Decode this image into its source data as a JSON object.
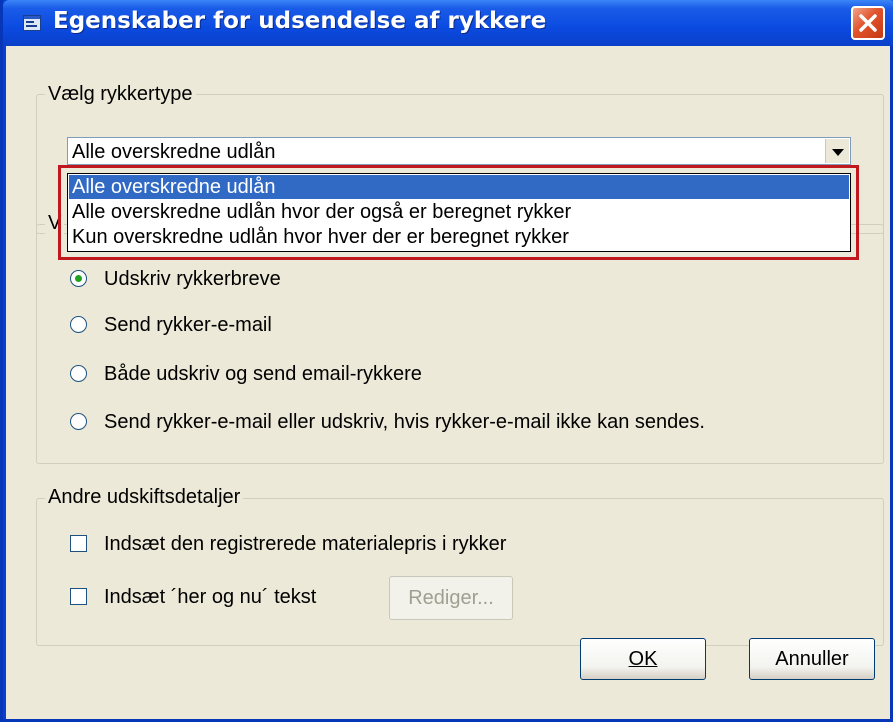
{
  "window": {
    "title": "Egenskaber for udsendelse af rykkere",
    "icon": "app-window-icon",
    "close_icon": "close-icon",
    "accent": "#0a3fd4",
    "dialog_bg": "#ece9d8"
  },
  "reminder_type_group": {
    "legend": "Vælg rykkertype",
    "combo_value": "Alle overskredne udlån",
    "options": [
      "Alle overskredne udlån",
      "Alle overskredne udlån hvor der også er beregnet rykker",
      "Kun overskredne udlån hvor hver der er beregnet rykker"
    ],
    "selected_index": 0,
    "highlight_color": "#c0181e"
  },
  "delivery_group": {
    "legend_visible_fragment": "V",
    "options": [
      {
        "label": "Udskriv rykkerbreve",
        "selected": true
      },
      {
        "label": "Send rykker-e-mail",
        "selected": false
      },
      {
        "label": "Både udskriv og send email-rykkere",
        "selected": false
      },
      {
        "label": "Send rykker-e-mail eller udskriv, hvis rykker-e-mail ikke kan sendes.",
        "selected": false
      }
    ]
  },
  "other_details_group": {
    "legend": "Andre udskiftsdetaljer",
    "material_price_label": "Indsæt den registrerede materialepris i rykker",
    "material_price_checked": false,
    "here_now_label": "Indsæt ´her og nu´ tekst",
    "here_now_checked": false,
    "edit_button": "Rediger..."
  },
  "footer": {
    "ok_button": "OK",
    "cancel_button": "Annuller"
  }
}
